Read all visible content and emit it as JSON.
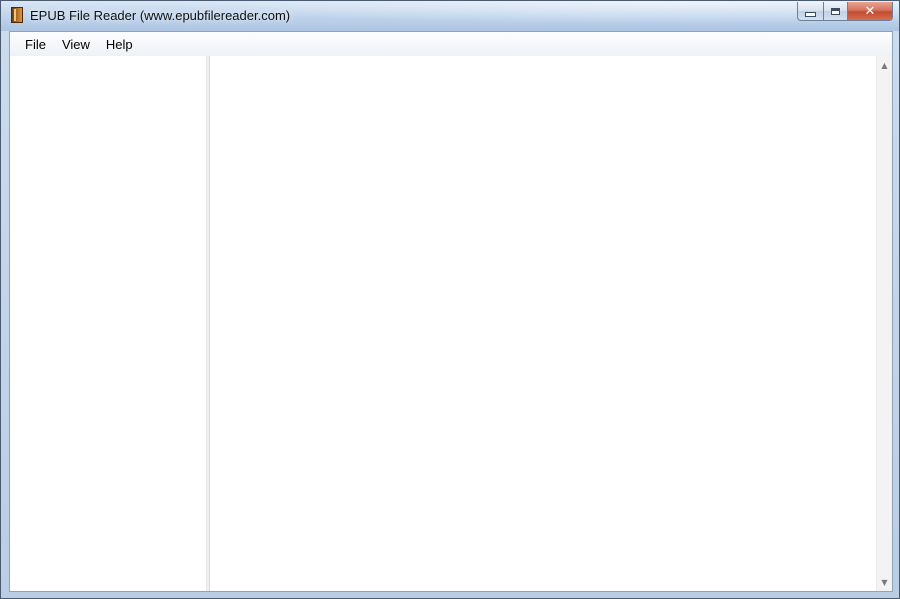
{
  "window": {
    "title": "EPUB File Reader (www.epubfilereader.com)",
    "app_icon": "book-icon",
    "caption_buttons": [
      "minimize",
      "maximize",
      "close"
    ],
    "close_glyph": "✕"
  },
  "menubar": {
    "items": [
      {
        "label": "File"
      },
      {
        "label": "View"
      },
      {
        "label": "Help"
      }
    ]
  },
  "scrollbar": {
    "up_glyph": "▲",
    "down_glyph": "▼"
  },
  "colors": {
    "titlebar": "#bcd1ea",
    "close_button": "#c24b30",
    "client_background": "#ffffff"
  }
}
